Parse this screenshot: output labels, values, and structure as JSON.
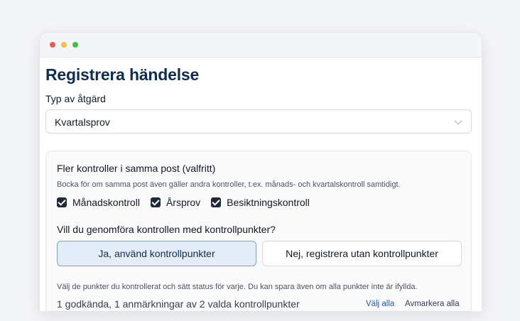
{
  "page": {
    "title": "Registrera händelse"
  },
  "action_type": {
    "label": "Typ av åtgärd",
    "selected": "Kvartalsprov"
  },
  "multi_controls": {
    "heading": "Fler kontroller i samma post (valfritt)",
    "help": "Bocka för om samma post även gäller andra kontroller, t.ex. månads- och kvartalskontroll samtidigt.",
    "options": [
      {
        "label": "Månadskontroll",
        "checked": true
      },
      {
        "label": "Årsprov",
        "checked": true
      },
      {
        "label": "Besiktningskontroll",
        "checked": true
      }
    ]
  },
  "checkpoints": {
    "question": "Vill du genomföra kontrollen med kontrollpunkter?",
    "yes_label": "Ja, använd kontrollpunkter",
    "no_label": "Nej, registrera utan kontrollpunkter",
    "selected": "yes",
    "instructions": "Välj de punkter du kontrollerat och sätt status för varje. Du kan spara även om alla punkter inte är ifyllda.",
    "summary": "1 godkända, 1 anmärkningar av 2 valda kontrollpunkter",
    "select_all": "Välj alla",
    "deselect_all": "Avmarkera alla"
  },
  "colors": {
    "title": "#0f2d52",
    "selected_button_bg": "#e3ecf7",
    "selected_button_border": "#7ea2cc",
    "link": "#1d5fa8",
    "checkbox": "#1f2937"
  }
}
